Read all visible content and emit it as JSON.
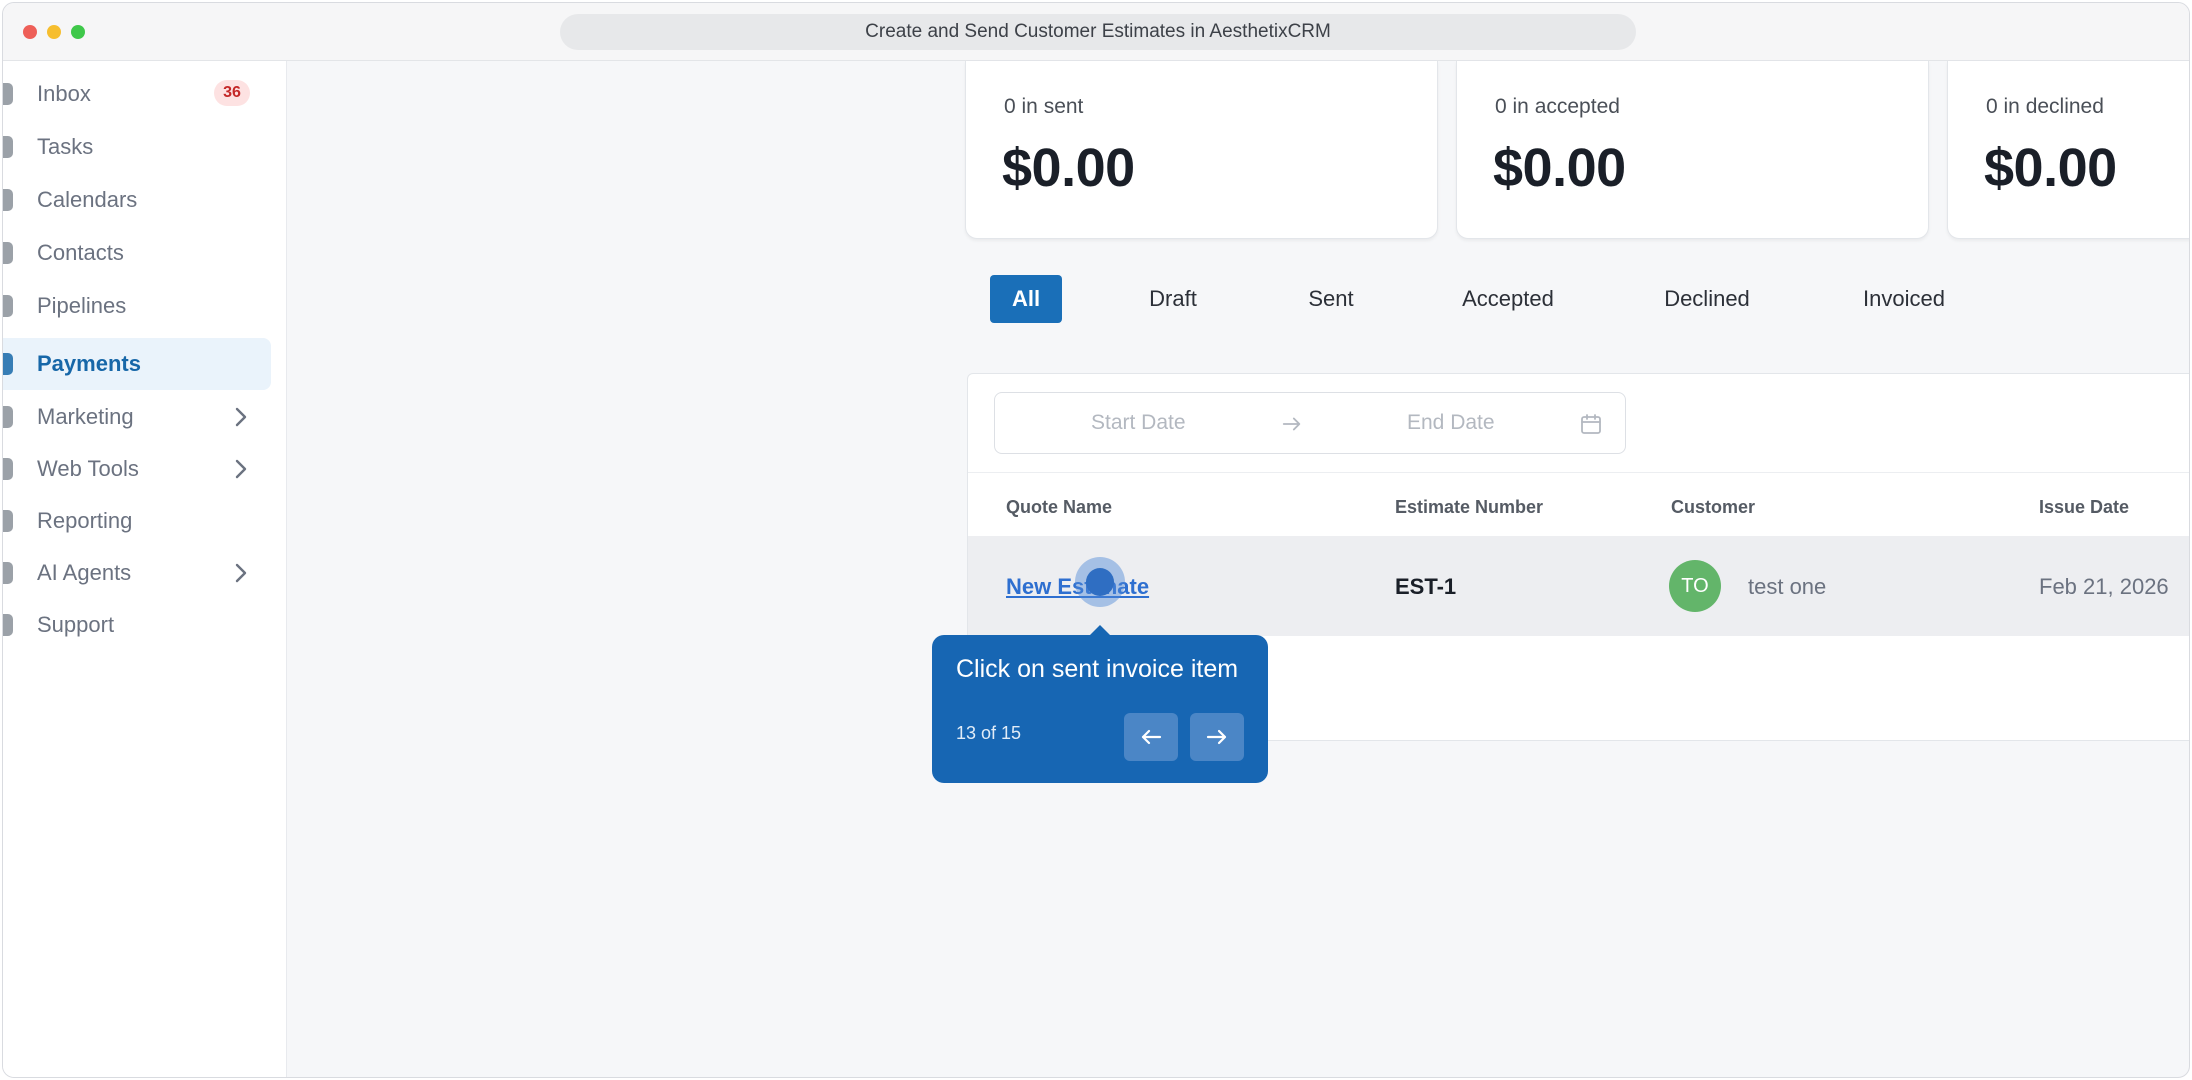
{
  "window": {
    "title": "Create and Send Customer Estimates in AesthetixCRM"
  },
  "sidebar": {
    "items": [
      {
        "label": "Inbox",
        "badge": "36"
      },
      {
        "label": "Tasks"
      },
      {
        "label": "Calendars"
      },
      {
        "label": "Contacts"
      },
      {
        "label": "Pipelines"
      },
      {
        "label": "Payments",
        "active": true
      },
      {
        "label": "Marketing",
        "expandable": true
      },
      {
        "label": "Web Tools",
        "expandable": true
      },
      {
        "label": "Reporting"
      },
      {
        "label": "AI Agents",
        "expandable": true
      },
      {
        "label": "Support"
      }
    ]
  },
  "summary_cards": [
    {
      "caption": "0 in sent",
      "amount": "$0.00"
    },
    {
      "caption": "0 in accepted",
      "amount": "$0.00"
    },
    {
      "caption": "0 in declined",
      "amount": "$0.00"
    }
  ],
  "filter_tabs": [
    {
      "label": "All",
      "active": true
    },
    {
      "label": "Draft"
    },
    {
      "label": "Sent"
    },
    {
      "label": "Accepted"
    },
    {
      "label": "Declined"
    },
    {
      "label": "Invoiced"
    }
  ],
  "date_range": {
    "start_placeholder": "Start Date",
    "end_placeholder": "End Date"
  },
  "table": {
    "headers": [
      "Quote Name",
      "Estimate Number",
      "Customer",
      "Issue Date"
    ],
    "rows": [
      {
        "quote_name": "New Estimate",
        "estimate_number": "EST-1",
        "customer_initials": "TO",
        "customer_name": "test one",
        "issue_date": "Feb 21, 2026"
      }
    ]
  },
  "tooltip": {
    "message": "Click on sent invoice item",
    "step": "13 of 15"
  },
  "colors": {
    "accent": "#1a6fb8",
    "tooltip": "#1766b3",
    "badge_bg": "#fde2e2",
    "badge_text": "#c42828",
    "avatar": "#63b56a"
  }
}
